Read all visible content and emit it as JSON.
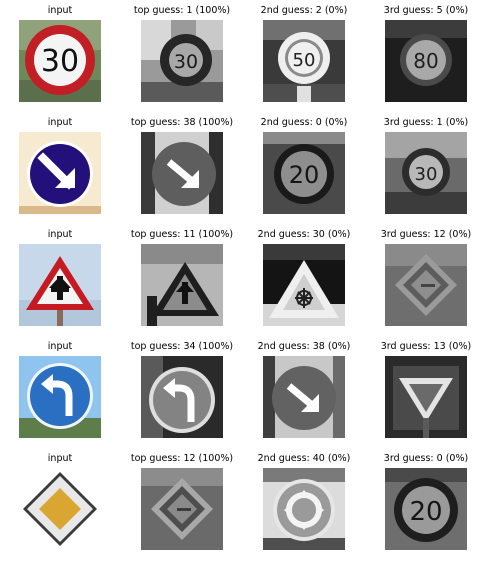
{
  "rows": [
    {
      "labels": [
        "input",
        "top guess: 1 (100%)",
        "2nd guess: 2 (0%)",
        "3rd guess: 5 (0%)"
      ],
      "images": [
        "speed-limit-30-sign-color",
        "speed-limit-30-sign-gray",
        "speed-limit-50-sign-gray",
        "speed-limit-80-sign-gray"
      ]
    },
    {
      "labels": [
        "input",
        "top guess: 38 (100%)",
        "2nd guess: 0 (0%)",
        "3rd guess: 1 (0%)"
      ],
      "images": [
        "keep-right-sign-color",
        "keep-right-sign-gray",
        "speed-limit-20-sign-gray",
        "speed-limit-30-sign-gray"
      ]
    },
    {
      "labels": [
        "input",
        "top guess: 11 (100%)",
        "2nd guess: 30 (0%)",
        "3rd guess: 12 (0%)"
      ],
      "images": [
        "right-of-way-sign-color",
        "right-of-way-sign-gray",
        "ice-snow-sign-gray",
        "priority-road-sign-gray"
      ]
    },
    {
      "labels": [
        "input",
        "top guess: 34 (100%)",
        "2nd guess: 38 (0%)",
        "3rd guess: 13 (0%)"
      ],
      "images": [
        "turn-left-ahead-sign-color",
        "turn-left-ahead-sign-gray",
        "keep-right-sign-gray",
        "yield-sign-gray"
      ]
    },
    {
      "labels": [
        "input",
        "top guess: 12 (100%)",
        "2nd guess: 40 (0%)",
        "3rd guess: 0 (0%)"
      ],
      "images": [
        "priority-road-sign-color",
        "priority-road-sign-gray",
        "roundabout-sign-gray",
        "speed-limit-20-sign-gray"
      ]
    }
  ]
}
